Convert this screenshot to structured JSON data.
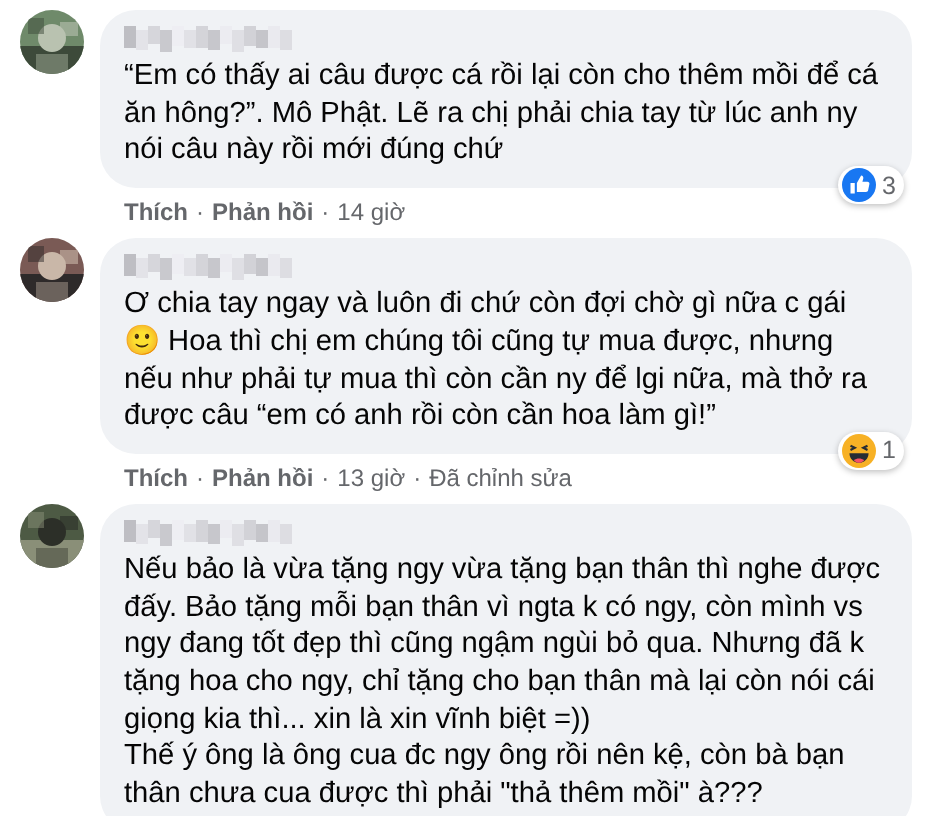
{
  "comments": [
    {
      "text": "“Em có thấy ai câu được cá rồi lại còn cho thêm mồi để cá ăn hông?”. Mô Phật. Lẽ ra chị phải chia tay từ lúc anh ny nói câu này rồi mới đúng chứ",
      "reaction": {
        "kind": "like",
        "count": "3"
      },
      "meta": [
        {
          "kind": "link",
          "label": "Thích"
        },
        {
          "kind": "sep",
          "label": "·"
        },
        {
          "kind": "link",
          "label": "Phản hồi"
        },
        {
          "kind": "sep",
          "label": "·"
        },
        {
          "kind": "time",
          "label": "14 giờ"
        }
      ]
    },
    {
      "text": "Ơ chia tay ngay và luôn đi chứ còn đợi chờ gì nữa c gái 🙂 Hoa thì chị em chúng tôi cũng tự mua được, nhưng nếu như phải tự mua thì còn cần ny để lgi nữa, mà thở ra được câu “em có anh rồi còn cần hoa làm gì!”",
      "reaction": {
        "kind": "haha",
        "count": "1"
      },
      "meta": [
        {
          "kind": "link",
          "label": "Thích"
        },
        {
          "kind": "sep",
          "label": "·"
        },
        {
          "kind": "link",
          "label": "Phản hồi"
        },
        {
          "kind": "sep",
          "label": "·"
        },
        {
          "kind": "time",
          "label": "13 giờ"
        },
        {
          "kind": "sep",
          "label": "·"
        },
        {
          "kind": "time",
          "label": "Đã chỉnh sửa"
        }
      ]
    },
    {
      "text": "Nếu bảo là vừa tặng ngy vừa tặng bạn thân thì nghe được đấy. Bảo tặng mỗi bạn thân vì ngta k có ngy, còn mình vs ngy đang tốt đẹp thì cũng ngậm ngùi bỏ qua. Nhưng đã k tặng hoa cho ngy, chỉ tặng cho bạn thân mà lại còn nói cái giọng kia thì... xin là xin vĩnh biệt =))\nThế ý ông là ông cua đc ngy ông rồi nên kệ, còn bà bạn thân chưa cua được thì phải \"thả thêm mồi\" à???"
    }
  ]
}
